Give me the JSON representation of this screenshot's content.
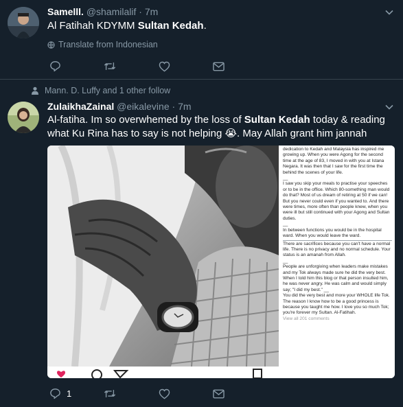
{
  "tweet1": {
    "display_name": "Samelll.",
    "handle": "@shamilalif",
    "time": "· 7m",
    "text_before": "Al Fatihah KDYMM ",
    "text_bold": "Sultan Kedah",
    "text_after": ".",
    "translate_label": "Translate from Indonesian",
    "avatar_icon": "user-avatar-icon"
  },
  "tweet2": {
    "social_context": "Mann. D. Luffy and 1 other follow",
    "display_name": "ZulaikhaZainal",
    "handle": "@eikalevine",
    "time": "· 7m",
    "text_part1": "Al-fatiha. Im so overwhemed by the loss of ",
    "text_bold": "Sultan Kedah",
    "text_part2": " today & reading what Ku Rina has to say is not helping ",
    "emoji": "😭",
    "text_part3": ". May Allah grant him jannah",
    "reply_count": "1",
    "caption_lines": [
      "dedication to Kedah and Malaysia has inspired me growing up. When you were Agong for the second time at the age of 83, I moved in with you at Istana Negara. It was then that I saw for the first time the behind the scenes of your life.",
      "__",
      "I saw you skip your meals to practise your speeches or to be in the office. Which 80-something man would do that? Most of us dream of retiring at 50 if we can! But you never could even if you wanted to. And there were times, more often than people knew, when you were ill but still continued with your Agong and Sultan duties.",
      "__",
      "In between functions you would be in the hospital ward. When you would leave the ward.",
      "There are sacrifices because you can't have a normal life. There is no privacy and no normal schedule. Your status is an amanah from Allah.",
      "__",
      "People are unforgiving when leaders make mistakes and my Tok always made sure he did the very best. When I told him this blog or that person insulted him, he was never angry. He was calm and would simply say; \"I did my best.\" __",
      "You did the very best and more your WHOLE life Tok. The reason I know how to be a good princess is because you taught me how. I love you so much Tok; you're forever my Sultan. Al-Fatihah."
    ],
    "view_comments": "View all 201 comments"
  },
  "colors": {
    "background": "#15202b",
    "divider": "#38444d",
    "secondary_text": "#8899a6",
    "primary_text": "#ffffff"
  }
}
